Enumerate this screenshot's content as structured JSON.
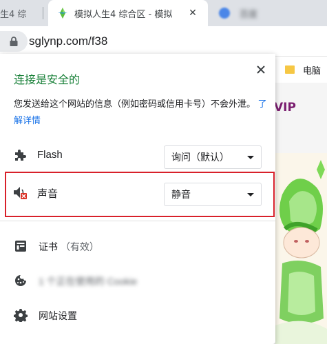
{
  "tabs": {
    "left": {
      "title": "生4 综"
    },
    "active": {
      "title": "模拟人生4 综合区 - 模拟",
      "close": "✕"
    },
    "right": {
      "title": "百度"
    }
  },
  "omnibox": {
    "url": "sglynp.com/f38"
  },
  "page": {
    "bookmark": "电脑",
    "vip": "VIP"
  },
  "popup": {
    "title": "连接是安全的",
    "close": "✕",
    "description": "您发送给这个网站的信息（例如密码或信用卡号）不会外泄。",
    "learn_more": "了解详情",
    "permissions": [
      {
        "label": "Flash",
        "value": "询问（默认）"
      },
      {
        "label": "声音",
        "value": "静音"
      }
    ],
    "certificate": {
      "label": "证书",
      "status": "（有效）"
    },
    "cookies": {
      "label": "1 个正在使用的 Cookie"
    },
    "site_settings": {
      "label": "网站设置"
    }
  },
  "colors": {
    "secure_green": "#188038",
    "link_blue": "#1a73e8",
    "highlight_red": "#d8202a"
  }
}
